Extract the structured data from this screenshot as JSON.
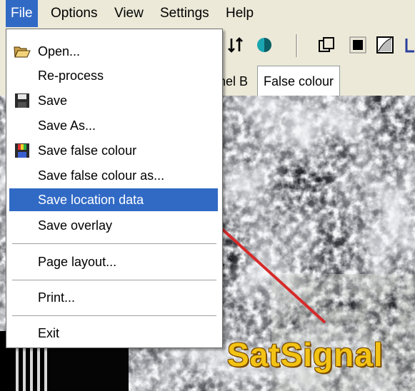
{
  "menubar": {
    "items": [
      {
        "label": "File"
      },
      {
        "label": "Options"
      },
      {
        "label": "View"
      },
      {
        "label": "Settings"
      },
      {
        "label": "Help"
      }
    ],
    "active_index": 0
  },
  "tabs": {
    "items": [
      {
        "label": "nel B"
      },
      {
        "label": "False colour"
      }
    ],
    "active_index": 1
  },
  "toolbar": {
    "icons": [
      "sort-arrows-icon",
      "colour-ball-icon",
      "window-icon",
      "black-square-icon",
      "gradient-icon",
      "partial-icon"
    ]
  },
  "file_menu": {
    "items": [
      {
        "label": "Open...",
        "icon": "open-folder-icon"
      },
      {
        "label": "Re-process",
        "icon": ""
      },
      {
        "label": "Save",
        "icon": "floppy-disk-icon"
      },
      {
        "label": "Save As...",
        "icon": ""
      },
      {
        "label": "Save false colour",
        "icon": "colour-floppy-icon"
      },
      {
        "label": "Save false colour as...",
        "icon": ""
      },
      {
        "label": "Save location data",
        "icon": "",
        "highlighted": true
      },
      {
        "label": "Save overlay",
        "icon": ""
      },
      {
        "label": "Page layout...",
        "icon": ""
      },
      {
        "label": "Print...",
        "icon": ""
      },
      {
        "label": "Exit",
        "icon": ""
      }
    ]
  },
  "watermark": {
    "text": "SatSignal"
  },
  "colors": {
    "highlight": "#316ac5",
    "menu_bg": "#ffffff",
    "chrome": "#ece9d8",
    "arrow": "#d62a2a",
    "watermark": "#f2c314"
  }
}
